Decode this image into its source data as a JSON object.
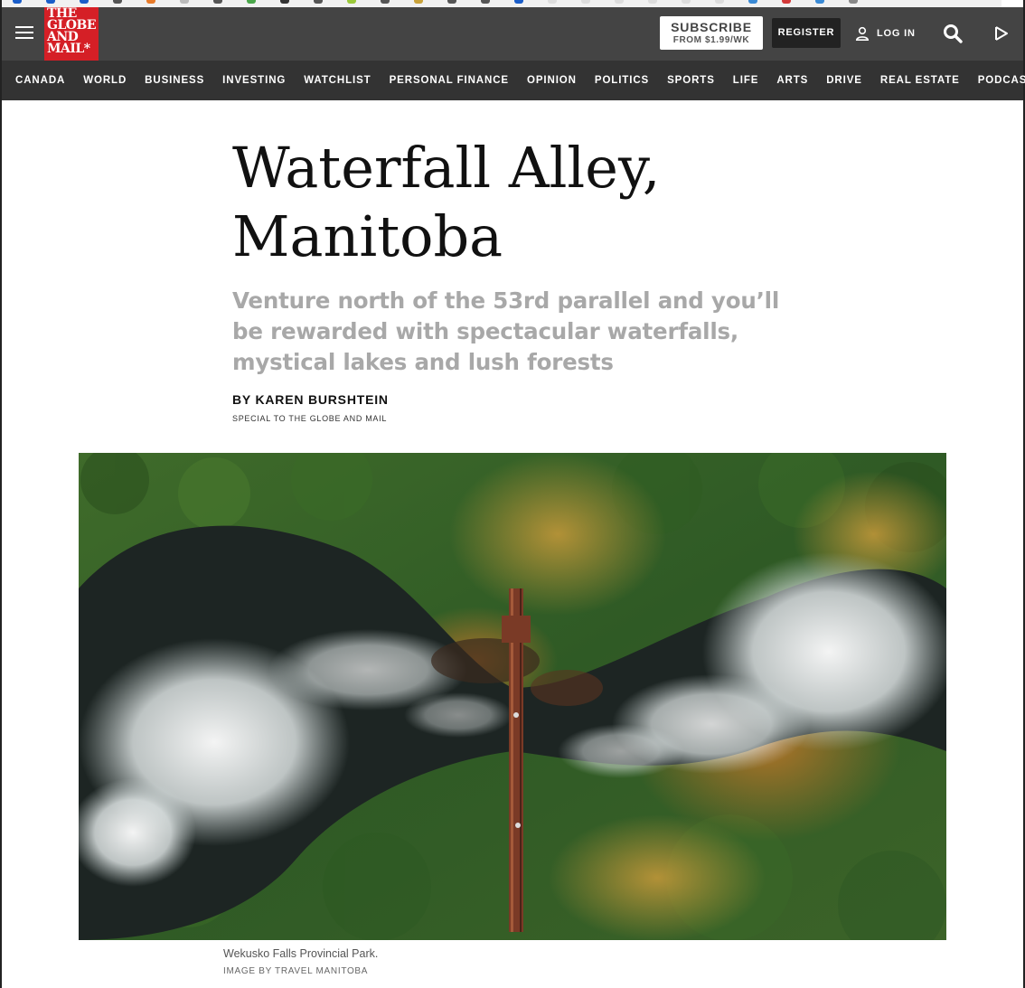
{
  "bookmarks": [
    {
      "color": "#1a5dc9"
    },
    {
      "color": "#1a5dc9"
    },
    {
      "color": "#1a5dc9"
    },
    {
      "color": "#555555"
    },
    {
      "color": "#e87b2a"
    },
    {
      "color": "#bbbbbb"
    },
    {
      "color": "#555555"
    },
    {
      "color": "#4aa64a"
    },
    {
      "color": "#333333"
    },
    {
      "color": "#555555"
    },
    {
      "color": "#9bc93a"
    },
    {
      "color": "#555555"
    },
    {
      "color": "#c9a23a"
    },
    {
      "color": "#555555"
    },
    {
      "color": "#555555"
    },
    {
      "color": "#1a5dc9"
    },
    {
      "color": "#dddddd"
    },
    {
      "color": "#dddddd"
    },
    {
      "color": "#dddddd"
    },
    {
      "color": "#dddddd"
    },
    {
      "color": "#dddddd"
    },
    {
      "color": "#dddddd"
    },
    {
      "color": "#3a8ad5"
    },
    {
      "color": "#d33a3a"
    },
    {
      "color": "#3a8ad5"
    },
    {
      "color": "#888888"
    }
  ],
  "header": {
    "logo": {
      "line1": "THE",
      "line2": "GLOBE",
      "line3": "AND",
      "line4": "MAIL*"
    },
    "subscribe": {
      "label": "SUBSCRIBE",
      "price": "FROM $1.99/WK"
    },
    "register_label": "REGISTER",
    "login_label": "LOG IN",
    "icons": {
      "menu": "hamburger-menu-icon",
      "user": "user-icon",
      "search": "search-icon",
      "play": "play-icon"
    }
  },
  "nav": {
    "items": [
      "CANADA",
      "WORLD",
      "BUSINESS",
      "INVESTING",
      "WATCHLIST",
      "PERSONAL FINANCE",
      "OPINION",
      "POLITICS",
      "SPORTS",
      "LIFE",
      "ARTS",
      "DRIVE",
      "REAL ESTATE",
      "PODCASTS"
    ]
  },
  "article": {
    "headline_line1": "Waterfall Alley,",
    "headline_line2": "Manitoba",
    "dek": "Venture north of the 53rd parallel and you’ll be rewarded with spectacular waterfalls, mystical lakes and lush forests",
    "byline": "BY KAREN BURSHTEIN",
    "byline_sub": "SPECIAL TO THE GLOBE AND MAIL",
    "image_caption": "Wekusko Falls Provincial Park.",
    "image_credit": "IMAGE BY TRAVEL MANITOBA"
  },
  "colors": {
    "header_bg": "#444444",
    "nav_bg": "#333333",
    "logo_red": "#d51f26",
    "dek_gray": "#a8a8a8"
  }
}
